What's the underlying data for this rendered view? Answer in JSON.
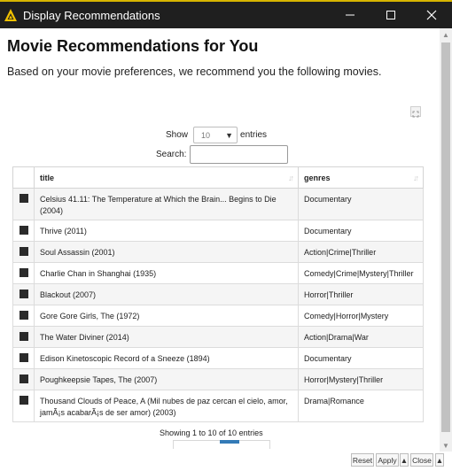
{
  "window": {
    "title": "Display Recommendations",
    "accent_color": "#d6b400"
  },
  "page": {
    "heading": "Movie Recommendations for You",
    "subtitle": "Based on your movie preferences, we recommend you the following movies."
  },
  "controls": {
    "show_label": "Show",
    "entries_value": "10",
    "entries_label": "entries",
    "search_label": "Search:",
    "search_value": ""
  },
  "table": {
    "columns": [
      "title",
      "genres"
    ],
    "rows": [
      {
        "title": "Celsius 41.11: The Temperature at Which the Brain... Begins to Die (2004)",
        "genres": "Documentary"
      },
      {
        "title": "Thrive (2011)",
        "genres": "Documentary"
      },
      {
        "title": "Soul Assassin (2001)",
        "genres": "Action|Crime|Thriller"
      },
      {
        "title": "Charlie Chan in Shanghai (1935)",
        "genres": "Comedy|Crime|Mystery|Thriller"
      },
      {
        "title": "Blackout (2007)",
        "genres": "Horror|Thriller"
      },
      {
        "title": "Gore Gore Girls, The (1972)",
        "genres": "Comedy|Horror|Mystery"
      },
      {
        "title": "The Water Diviner (2014)",
        "genres": "Action|Drama|War"
      },
      {
        "title": "Edison Kinetoscopic Record of a Sneeze (1894)",
        "genres": "Documentary"
      },
      {
        "title": "Poughkeepsie Tapes, The (2007)",
        "genres": "Horror|Mystery|Thriller"
      },
      {
        "title": "Thousand Clouds of Peace, A (Mil nubes de paz cercan el cielo, amor, jamÃ¡s acabarÃ¡s de ser amor) (2003)",
        "genres": "Drama|Romance"
      }
    ]
  },
  "info": "Showing 1 to 10 of 10 entries",
  "footer": {
    "reset": "Reset",
    "apply": "Apply",
    "close": "Close"
  }
}
